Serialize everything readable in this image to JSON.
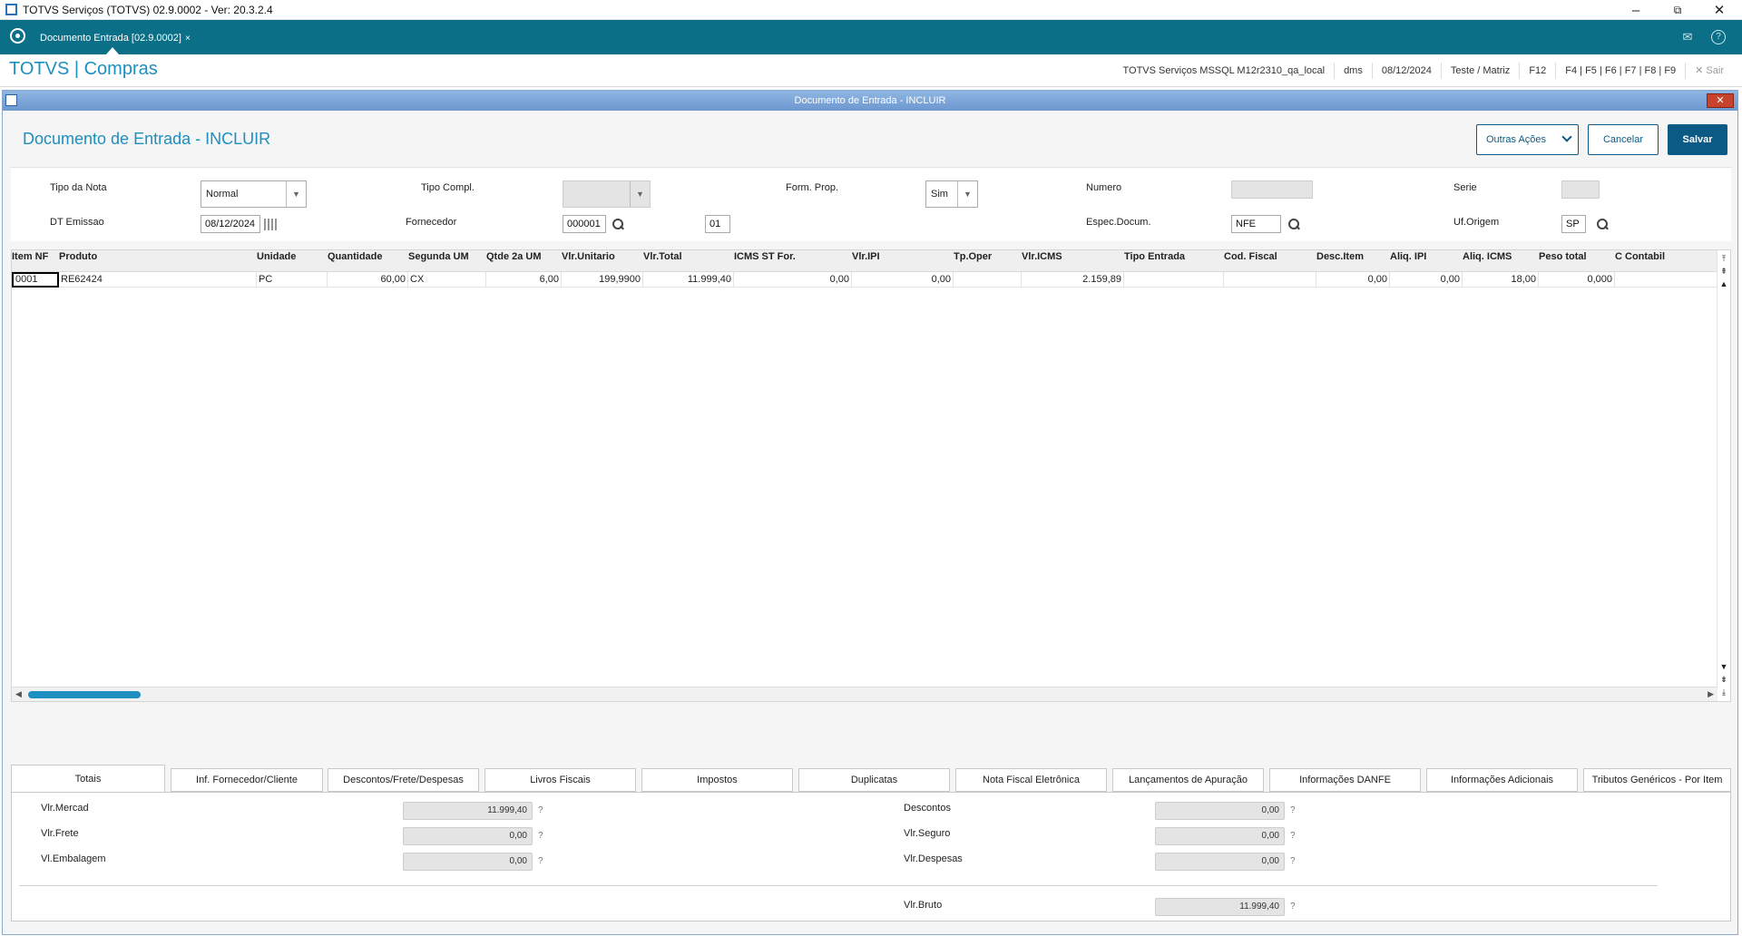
{
  "window": {
    "title": "TOTVS Serviços (TOTVS) 02.9.0002 - Ver: 20.3.2.4",
    "minimize": "–",
    "maximize": "⧉",
    "close": "✕"
  },
  "tabbar": {
    "tab_label": "Documento Entrada [02.9.0002]",
    "tab_close": "×",
    "mail_icon": "✉",
    "help_icon": "?"
  },
  "header": {
    "brand": "TOTVS | Compras",
    "env": "TOTVS Serviços MSSQL M12r2310_qa_local",
    "user": "dms",
    "date": "08/12/2024",
    "branch": "Teste / Matriz",
    "f12": "F12",
    "fkeys": "F4 | F5 | F6 | F7 | F8 | F9",
    "exit_label": "✕  Sair"
  },
  "modal": {
    "title": "Documento de Entrada - INCLUIR",
    "close": "✕"
  },
  "page": {
    "title": "Documento de Entrada - INCLUIR",
    "btn_other": "Outras Ações",
    "btn_cancel": "Cancelar",
    "btn_save": "Salvar"
  },
  "form": {
    "tipo_nota_label": "Tipo da Nota",
    "tipo_nota_value": "Normal",
    "tipo_compl_label": "Tipo Compl.",
    "tipo_compl_value": "",
    "form_prop_label": "Form. Prop.",
    "form_prop_value": "Sim",
    "numero_label": "Numero",
    "numero_value": "",
    "serie_label": "Serie",
    "serie_value": "",
    "dt_emissao_label": "DT Emissao",
    "dt_emissao_value": "08/12/2024",
    "fornecedor_label": "Fornecedor",
    "fornecedor_value": "000001",
    "loja_value": "01",
    "espec_label": "Espec.Docum.",
    "espec_value": "NFE",
    "uf_label": "Uf.Origem",
    "uf_value": "SP"
  },
  "grid": {
    "columns": [
      "Item NF",
      "Produto",
      "Unidade",
      "Quantidade",
      "Segunda UM",
      "Qtde 2a UM",
      "Vlr.Unitario",
      "Vlr.Total",
      "ICMS ST For.",
      "Vlr.IPI",
      "Tp.Oper",
      "Vlr.ICMS",
      "Tipo Entrada",
      "Cod. Fiscal",
      "Desc.Item",
      "Aliq. IPI",
      "Aliq. ICMS",
      "Peso total",
      "C Contabil"
    ],
    "rows": [
      [
        "0001",
        "RE62424",
        "PC",
        "60,00",
        "CX",
        "6,00",
        "199,9900",
        "11.999,40",
        "0,00",
        "0,00",
        "",
        "2.159,89",
        "",
        "",
        "0,00",
        "0,00",
        "18,00",
        "0,000",
        ""
      ]
    ]
  },
  "tabs": [
    "Totais",
    "Inf. Fornecedor/Cliente",
    "Descontos/Frete/Despesas",
    "Livros Fiscais",
    "Impostos",
    "Duplicatas",
    "Nota Fiscal Eletrônica",
    "Lançamentos de Apuração",
    "Informações DANFE",
    "Informações Adicionais",
    "Tributos Genéricos - Por Item"
  ],
  "totals": {
    "vlr_mercad_label": "Vlr.Mercad",
    "vlr_mercad": "11.999,40",
    "vlr_frete_label": "Vlr.Frete",
    "vlr_frete": "0,00",
    "vl_embalagem_label": "Vl.Embalagem",
    "vl_embalagem": "0,00",
    "descontos_label": "Descontos",
    "descontos": "0,00",
    "vlr_seguro_label": "Vlr.Seguro",
    "vlr_seguro": "0,00",
    "vlr_despesas_label": "Vlr.Despesas",
    "vlr_despesas": "0,00",
    "vlr_bruto_label": "Vlr.Bruto",
    "vlr_bruto": "11.999,40",
    "help_mark": "?"
  },
  "colors": {
    "teal_bar": "#0a6f87",
    "brand_blue": "#1d8fc0",
    "primary_button": "#0a5a85"
  }
}
